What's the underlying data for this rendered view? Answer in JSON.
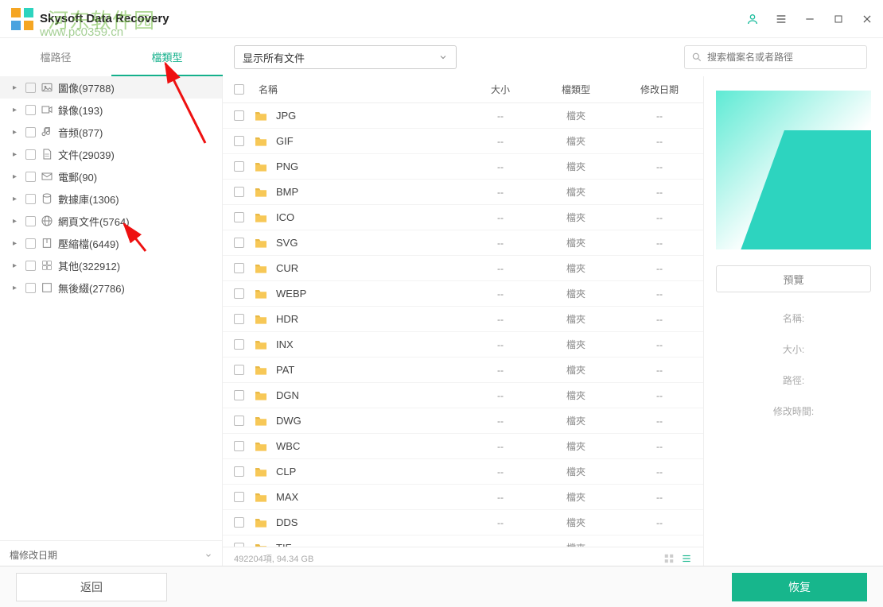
{
  "app": {
    "title": "Skysoft Data Recovery"
  },
  "watermark": {
    "top": "河东软件园",
    "url": "www.pc0359.cn"
  },
  "tabs": {
    "path": "檔路径",
    "type": "檔類型"
  },
  "filter": {
    "label": "显示所有文件"
  },
  "search": {
    "placeholder": "搜索檔案名或者路徑"
  },
  "sidebar": {
    "items": [
      {
        "label": "圖像(97788)",
        "icon": "image"
      },
      {
        "label": "錄像(193)",
        "icon": "video"
      },
      {
        "label": "音频(877)",
        "icon": "audio"
      },
      {
        "label": "文件(29039)",
        "icon": "doc"
      },
      {
        "label": "電郵(90)",
        "icon": "mail"
      },
      {
        "label": "數據庫(1306)",
        "icon": "db"
      },
      {
        "label": "網頁文件(5764)",
        "icon": "web"
      },
      {
        "label": "壓縮檔(6449)",
        "icon": "zip"
      },
      {
        "label": "其他(322912)",
        "icon": "other"
      },
      {
        "label": "無後綴(27786)",
        "icon": "none"
      }
    ],
    "footer": "檔修改日期"
  },
  "columns": {
    "name": "名稱",
    "size": "大小",
    "type": "檔類型",
    "date": "修改日期"
  },
  "folder_type": "檔夾",
  "dash": "--",
  "files": [
    "JPG",
    "GIF",
    "PNG",
    "BMP",
    "ICO",
    "SVG",
    "CUR",
    "WEBP",
    "HDR",
    "INX",
    "PAT",
    "DGN",
    "DWG",
    "WBC",
    "CLP",
    "MAX",
    "DDS",
    "TIF"
  ],
  "status": {
    "count": "492204項, 94.34 GB"
  },
  "preview": {
    "button": "預覽",
    "name_label": "名稱:",
    "size_label": "大小:",
    "path_label": "路徑:",
    "time_label": "修改時間:"
  },
  "bottom": {
    "back": "返回",
    "recover": "恢复"
  }
}
